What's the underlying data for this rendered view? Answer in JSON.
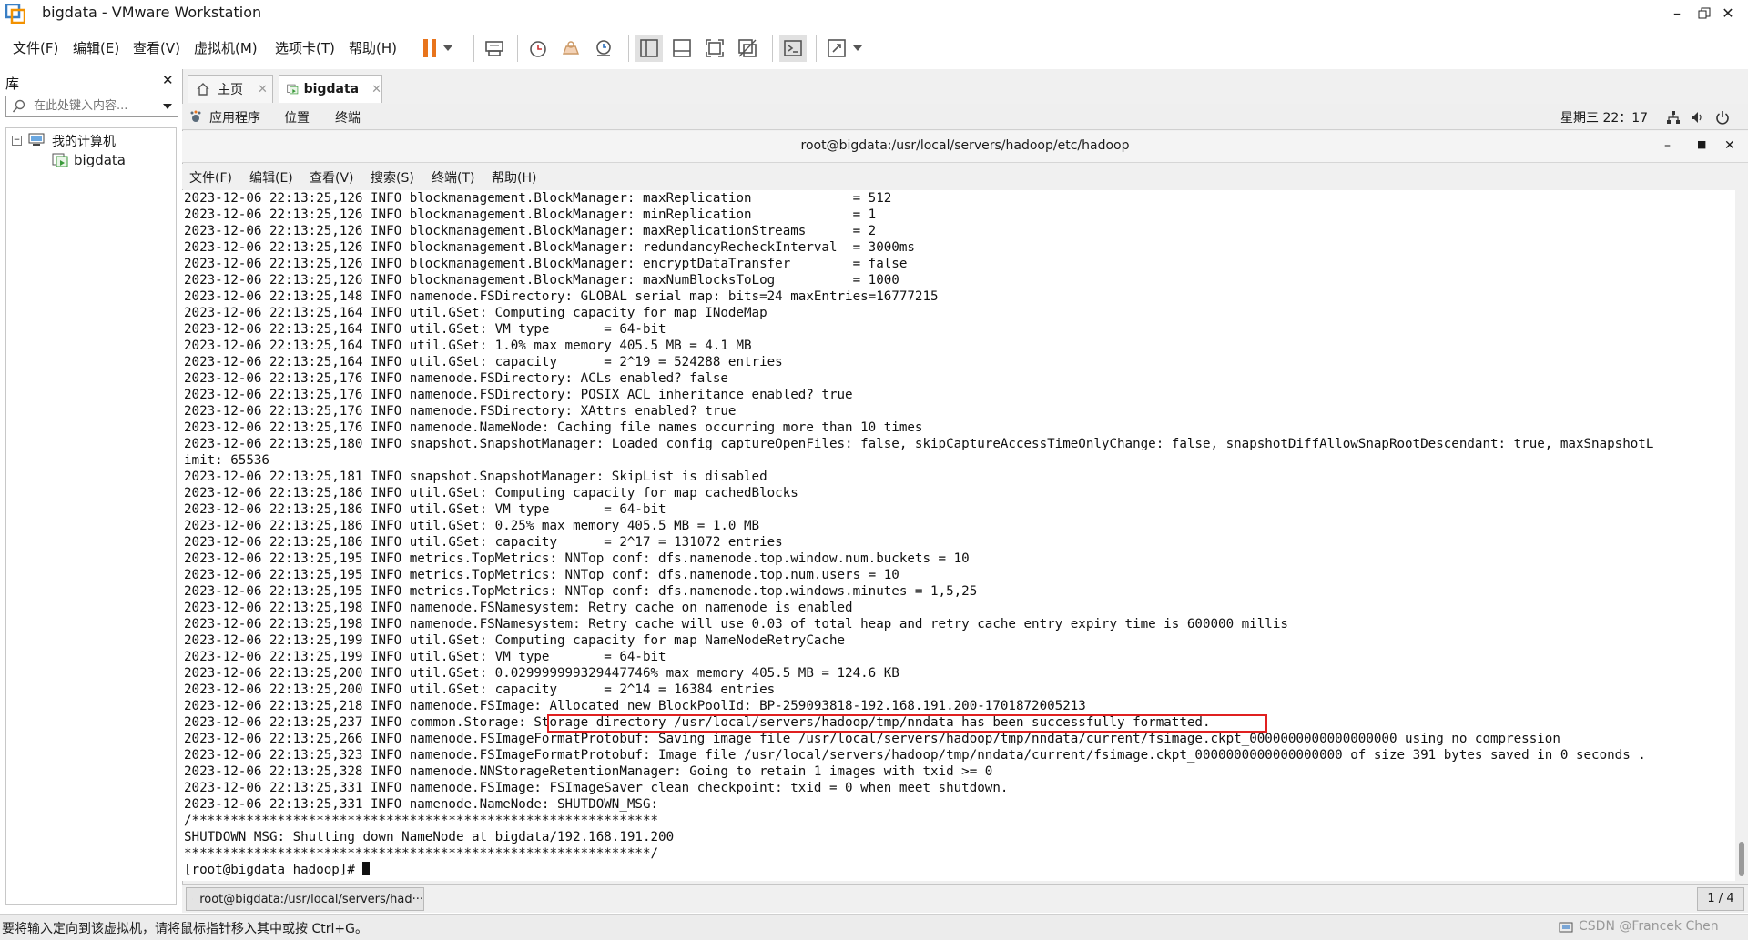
{
  "window": {
    "title": "bigdata - VMware Workstation"
  },
  "menu": [
    "文件(F)",
    "编辑(E)",
    "查看(V)",
    "虚拟机(M)",
    "选项卡(T)",
    "帮助(H)"
  ],
  "library": {
    "title": "库",
    "search_placeholder": "在此处键入内容...",
    "tree_root": "我的计算机",
    "tree_child": "bigdata"
  },
  "tabs": [
    {
      "label": "主页"
    },
    {
      "label": "bigdata"
    }
  ],
  "guest_bar": {
    "apps": "应用程序",
    "places": "位置",
    "terminal": "终端",
    "clock": "星期三 22：17"
  },
  "terminal": {
    "title": "root@bigdata:/usr/local/servers/hadoop/etc/hadoop",
    "menu": [
      "文件(F)",
      "编辑(E)",
      "查看(V)",
      "搜索(S)",
      "终端(T)",
      "帮助(H)"
    ],
    "lines": [
      "2023-12-06 22:13:25,126 INFO blockmanagement.BlockManager: maxReplication             = 512",
      "2023-12-06 22:13:25,126 INFO blockmanagement.BlockManager: minReplication             = 1",
      "2023-12-06 22:13:25,126 INFO blockmanagement.BlockManager: maxReplicationStreams      = 2",
      "2023-12-06 22:13:25,126 INFO blockmanagement.BlockManager: redundancyRecheckInterval  = 3000ms",
      "2023-12-06 22:13:25,126 INFO blockmanagement.BlockManager: encryptDataTransfer        = false",
      "2023-12-06 22:13:25,126 INFO blockmanagement.BlockManager: maxNumBlocksToLog          = 1000",
      "2023-12-06 22:13:25,148 INFO namenode.FSDirectory: GLOBAL serial map: bits=24 maxEntries=16777215",
      "2023-12-06 22:13:25,164 INFO util.GSet: Computing capacity for map INodeMap",
      "2023-12-06 22:13:25,164 INFO util.GSet: VM type       = 64-bit",
      "2023-12-06 22:13:25,164 INFO util.GSet: 1.0% max memory 405.5 MB = 4.1 MB",
      "2023-12-06 22:13:25,164 INFO util.GSet: capacity      = 2^19 = 524288 entries",
      "2023-12-06 22:13:25,176 INFO namenode.FSDirectory: ACLs enabled? false",
      "2023-12-06 22:13:25,176 INFO namenode.FSDirectory: POSIX ACL inheritance enabled? true",
      "2023-12-06 22:13:25,176 INFO namenode.FSDirectory: XAttrs enabled? true",
      "2023-12-06 22:13:25,176 INFO namenode.NameNode: Caching file names occurring more than 10 times",
      "2023-12-06 22:13:25,180 INFO snapshot.SnapshotManager: Loaded config captureOpenFiles: false, skipCaptureAccessTimeOnlyChange: false, snapshotDiffAllowSnapRootDescendant: true, maxSnapshotL",
      "imit: 65536",
      "2023-12-06 22:13:25,181 INFO snapshot.SnapshotManager: SkipList is disabled",
      "2023-12-06 22:13:25,186 INFO util.GSet: Computing capacity for map cachedBlocks",
      "2023-12-06 22:13:25,186 INFO util.GSet: VM type       = 64-bit",
      "2023-12-06 22:13:25,186 INFO util.GSet: 0.25% max memory 405.5 MB = 1.0 MB",
      "2023-12-06 22:13:25,186 INFO util.GSet: capacity      = 2^17 = 131072 entries",
      "2023-12-06 22:13:25,195 INFO metrics.TopMetrics: NNTop conf: dfs.namenode.top.window.num.buckets = 10",
      "2023-12-06 22:13:25,195 INFO metrics.TopMetrics: NNTop conf: dfs.namenode.top.num.users = 10",
      "2023-12-06 22:13:25,195 INFO metrics.TopMetrics: NNTop conf: dfs.namenode.top.windows.minutes = 1,5,25",
      "2023-12-06 22:13:25,198 INFO namenode.FSNamesystem: Retry cache on namenode is enabled",
      "2023-12-06 22:13:25,198 INFO namenode.FSNamesystem: Retry cache will use 0.03 of total heap and retry cache entry expiry time is 600000 millis",
      "2023-12-06 22:13:25,199 INFO util.GSet: Computing capacity for map NameNodeRetryCache",
      "2023-12-06 22:13:25,199 INFO util.GSet: VM type       = 64-bit",
      "2023-12-06 22:13:25,200 INFO util.GSet: 0.029999999329447746% max memory 405.5 MB = 124.6 KB",
      "2023-12-06 22:13:25,200 INFO util.GSet: capacity      = 2^14 = 16384 entries",
      "2023-12-06 22:13:25,218 INFO namenode.FSImage: Allocated new BlockPoolId: BP-259093818-192.168.191.200-1701872005213",
      "2023-12-06 22:13:25,237 INFO common.Storage: Storage directory /usr/local/servers/hadoop/tmp/nndata has been successfully formatted.",
      "2023-12-06 22:13:25,266 INFO namenode.FSImageFormatProtobuf: Saving image file /usr/local/servers/hadoop/tmp/nndata/current/fsimage.ckpt_0000000000000000000 using no compression",
      "2023-12-06 22:13:25,323 INFO namenode.FSImageFormatProtobuf: Image file /usr/local/servers/hadoop/tmp/nndata/current/fsimage.ckpt_0000000000000000000 of size 391 bytes saved in 0 seconds .",
      "2023-12-06 22:13:25,328 INFO namenode.NNStorageRetentionManager: Going to retain 1 images with txid >= 0",
      "2023-12-06 22:13:25,331 INFO namenode.FSImage: FSImageSaver clean checkpoint: txid = 0 when meet shutdown.",
      "2023-12-06 22:13:25,331 INFO namenode.NameNode: SHUTDOWN_MSG:",
      "/************************************************************",
      "SHUTDOWN_MSG: Shutting down NameNode at bigdata/192.168.191.200",
      "************************************************************/",
      "[root@bigdata hadoop]# "
    ]
  },
  "taskbar": {
    "item_label": "root@bigdata:/usr/local/servers/had···",
    "pager": "1 / 4"
  },
  "status": {
    "hint": "要将输入定向到该虚拟机，请将鼠标指针移入其中或按 Ctrl+G。",
    "watermark": "CSDN @Francek Chen"
  },
  "colors": {
    "highlight": "#e02020",
    "pause": "#e8741c"
  }
}
